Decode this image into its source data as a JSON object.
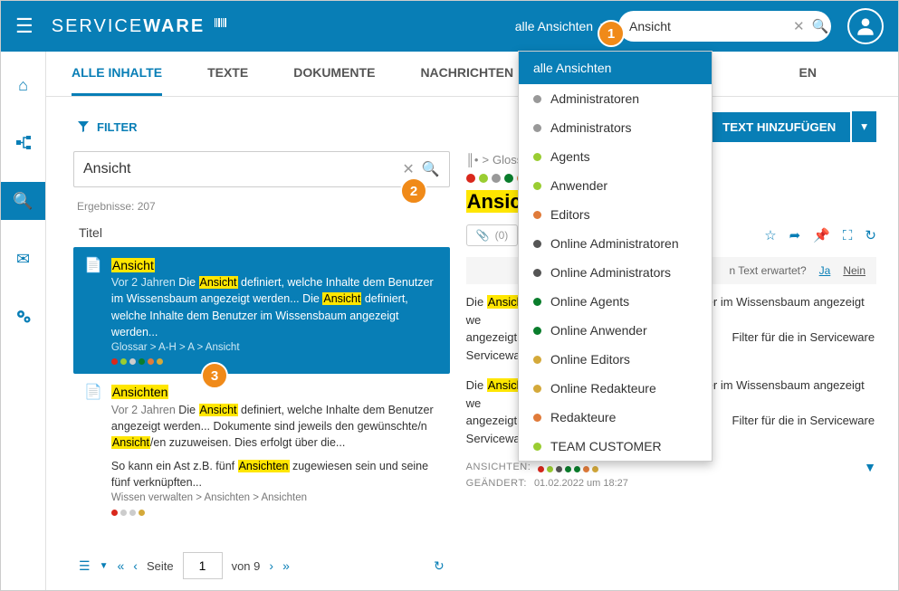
{
  "header": {
    "brand_prefix": "SERVICE",
    "brand_suffix": "WARE",
    "view_selector": "alle Ansichten",
    "search_value": "Ansicht"
  },
  "tabs": [
    "ALLE INHALTE",
    "TEXTE",
    "DOKUMENTE",
    "NACHRICHTEN",
    "EN"
  ],
  "toolbar": {
    "filter": "FILTER",
    "add_text": "TEXT HINZUFÜGEN"
  },
  "filter_input": "Ansicht",
  "results_label": "Ergebnisse: 207",
  "titel_header": "Titel",
  "result1": {
    "title_hl": "Ansicht",
    "age": "Vor 2 Jahren",
    "t1": " Die ",
    "t2": " definiert, welche Inhalte dem Benutzer im Wissensbaum angezeigt werden... Die ",
    "t3": " definiert, welche Inhalte dem Benutzer im Wissensbaum angezeigt werden...",
    "path": "Glossar > A-H > A > Ansicht"
  },
  "result2": {
    "title_hl": "Ansichten",
    "age": "Vor 2 Jahren",
    "t1": " Die ",
    "t2": " definiert, welche Inhalte dem Benutzer angezeigt werden... Dokumente sind jeweils den gewünschte/n ",
    "t3": "/en zuzuweisen. Dies erfolgt über die...",
    "p2a": "So kann ein Ast z.B. fünf ",
    "p2b": " zugewiesen sein und seine fünf verknüpften...",
    "path": "Wissen verwalten > Ansichten > Ansichten"
  },
  "pager": {
    "seite": "Seite",
    "page": "1",
    "von": "von 9"
  },
  "article": {
    "crumb_prefix": "> ",
    "crumb": "Glossar",
    "crumb_suffix": " > ...",
    "title_hl": "Ansicht",
    "attach_count": "(0)",
    "feedback_q": "n Text erwartet?",
    "ja": "Ja",
    "nein": "Nein",
    "p1a": "Die ",
    "p1b": " d",
    "p1c": "tzer im Wissensbaum angezeigt we",
    "p1d": " Filter für die in Serviceware",
    "p2a": "Die ",
    "p2b": " d",
    "p2c": "tzer im Wissensbaum angezeigt we",
    "p2d": " Filter für die in Serviceware",
    "ansichten_lbl": "ANSICHTEN:",
    "geaendert_lbl": "GEÄNDERT:",
    "geaendert_val": "01.02.2022 um 18:27"
  },
  "dropdown": {
    "head": "alle Ansichten",
    "items": [
      {
        "label": "Administratoren",
        "color": "#999"
      },
      {
        "label": "Administrators",
        "color": "#999"
      },
      {
        "label": "Agents",
        "color": "#9acd32"
      },
      {
        "label": "Anwender",
        "color": "#9acd32"
      },
      {
        "label": "Editors",
        "color": "#e07b3a"
      },
      {
        "label": "Online Administratoren",
        "color": "#555"
      },
      {
        "label": "Online Administrators",
        "color": "#555"
      },
      {
        "label": "Online Agents",
        "color": "#0a7d2c"
      },
      {
        "label": "Online Anwender",
        "color": "#0a7d2c"
      },
      {
        "label": "Online Editors",
        "color": "#d4a93a"
      },
      {
        "label": "Online Redakteure",
        "color": "#d4a93a"
      },
      {
        "label": "Redakteure",
        "color": "#e07b3a"
      },
      {
        "label": "TEAM CUSTOMER",
        "color": "#9acd32"
      }
    ]
  },
  "pane_dot_colors": [
    "#d9281c",
    "#9acd32",
    "#999",
    "#0a7d2c",
    "#e07b3a",
    "#d4a93a"
  ],
  "badges": {
    "b1": "1",
    "b2": "2",
    "b3": "3"
  }
}
